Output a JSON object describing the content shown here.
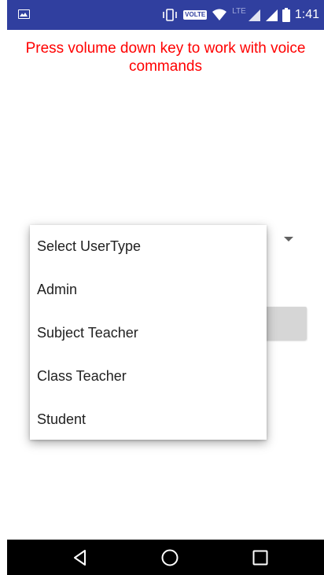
{
  "status_bar": {
    "time": "1:41",
    "volte_label": "VOLTE",
    "network_type": "LTE",
    "icons": [
      "image-icon",
      "vibrate-icon",
      "volte-icon",
      "wifi-icon",
      "signal-icon",
      "signal-icon",
      "battery-icon"
    ]
  },
  "header": {
    "message": "Press volume down key to work with voice commands"
  },
  "dropdown": {
    "items": [
      {
        "label": "Select UserType"
      },
      {
        "label": "Admin"
      },
      {
        "label": "Subject Teacher"
      },
      {
        "label": "Class Teacher"
      },
      {
        "label": "Student"
      }
    ]
  },
  "nav_bar": {
    "icons": [
      "back-icon",
      "home-icon",
      "recents-icon"
    ]
  },
  "colors": {
    "status_bar": "#303f9f",
    "message": "#ff0000",
    "nav_bar": "#000000"
  }
}
